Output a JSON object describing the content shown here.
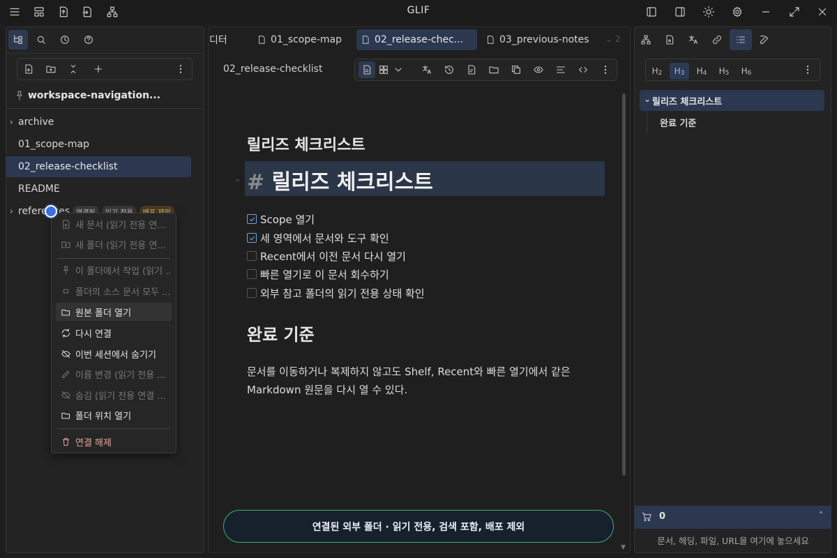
{
  "window": {
    "title": "GLIF"
  },
  "left_panel": {
    "workspace_name": "workspace-navigation...",
    "tree": [
      {
        "label": "archive",
        "folder": true
      },
      {
        "label": "01_scope-map"
      },
      {
        "label": "02_release-checklist",
        "active": true
      },
      {
        "label": "README"
      },
      {
        "label": "references",
        "folder": true,
        "tags": [
          "연결됨",
          "읽기 전용",
          "배포 제외"
        ]
      }
    ]
  },
  "context_menu": {
    "items": [
      {
        "label": "새 문서 (읽기 전용 연...",
        "disabled": true,
        "icon": "new-file-icon"
      },
      {
        "label": "새 폴더 (읽기 전용 연...",
        "disabled": true,
        "icon": "new-folder-icon"
      },
      {
        "label": "이 폴더에서 작업 (읽기 ...",
        "disabled": true,
        "icon": "pin-icon"
      },
      {
        "label": "폴더의 소스 문서 모두 ...",
        "disabled": true,
        "icon": "book-icon"
      },
      {
        "label": "원본 폴더 열기",
        "icon": "folder-open-icon",
        "highlight": true
      },
      {
        "label": "다시 연결",
        "icon": "refresh-icon"
      },
      {
        "label": "이번 세션에서 숨기기",
        "icon": "eye-off-icon"
      },
      {
        "label": "이름 변경 (읽기 전용 ...",
        "disabled": true,
        "icon": "pencil-icon"
      },
      {
        "label": "숨김 (읽기 전용 연결 ...",
        "disabled": true,
        "icon": "eye-off-icon"
      },
      {
        "label": "폴더 위치 열기",
        "icon": "folder-open-icon"
      },
      {
        "label": "연결 해제",
        "icon": "trash-icon",
        "danger": true
      }
    ]
  },
  "tabs": [
    {
      "label": "디터"
    },
    {
      "label": "01_scope-map"
    },
    {
      "label": "02_release-chec...",
      "active": true
    },
    {
      "label": "03_previous-notes"
    }
  ],
  "tabs_overflow": "2",
  "editor": {
    "breadcrumb": "02_release-checklist",
    "heading_rendered": "릴리즈 체크리스트",
    "heading_source_mark": "#",
    "heading_source_text": "릴리즈 체크리스트",
    "checklist": [
      {
        "text": "Scope 열기",
        "checked": true
      },
      {
        "text": "세 영역에서 문서와 도구 확인",
        "checked": true
      },
      {
        "text": "Recent에서 이전 문서 다시 열기",
        "checked": false
      },
      {
        "text": "빠른 열기로 이 문서 회수하기",
        "checked": false
      },
      {
        "text": "외부 참고 폴더의 읽기 전용 상태 확인",
        "checked": false
      }
    ],
    "heading2": "완료 기준",
    "paragraph_line1": "문서를 이동하거나 복제하지 않고도 Shelf, Recent와 빠른 열기에서 같은",
    "paragraph_line2": "Markdown 원문을 다시 열 수 있다.",
    "banner": "연결된 외부 폴더 · 읽기 전용, 검색 포함, 배포 제외"
  },
  "outline": {
    "heading_levels": [
      {
        "label": "H",
        "sub": "2"
      },
      {
        "label": "H",
        "sub": "3",
        "active": true
      },
      {
        "label": "H",
        "sub": "4"
      },
      {
        "label": "H",
        "sub": "5"
      },
      {
        "label": "H",
        "sub": "6"
      }
    ],
    "items": [
      {
        "label": "릴리즈 체크리스트",
        "level": 1
      },
      {
        "label": "완료 기준",
        "level": 2
      }
    ]
  },
  "cart": {
    "count": "0",
    "drop_hint": "문서, 헤딩, 파일, URL을 여기에 놓으세요"
  },
  "colors": {
    "accent": "#2c3850",
    "banner_border": "#3fae7a",
    "cursor": "#3a6fe0"
  }
}
